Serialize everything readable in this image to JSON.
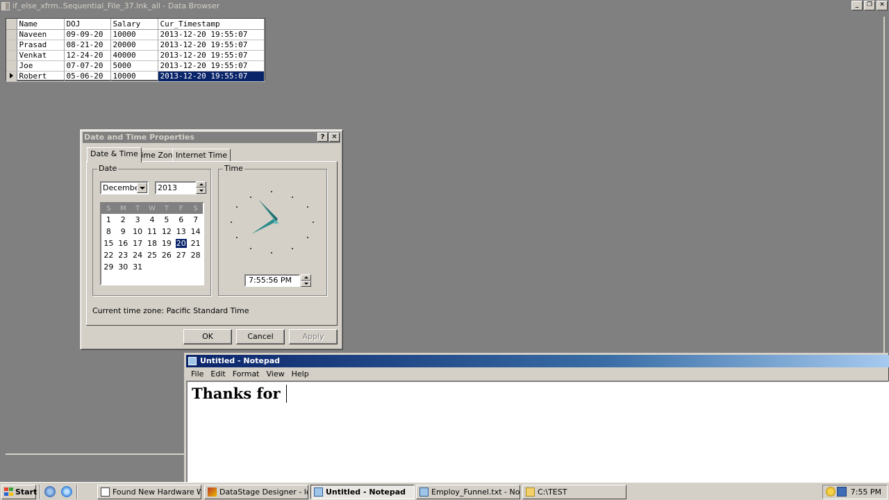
{
  "browser": {
    "title": "if_else_xfrm..Sequential_File_37.lnk_all - Data Browser",
    "columns": [
      "Name",
      "DOJ",
      "Salary",
      "Cur_Timestamp"
    ],
    "rows": [
      [
        "Naveen",
        "09-09-20",
        "10000",
        "2013-12-20 19:55:07"
      ],
      [
        "Prasad",
        "08-21-20",
        "20000",
        "2013-12-20 19:55:07"
      ],
      [
        "Venkat",
        "12-24-20",
        "40000",
        "2013-12-20 19:55:07"
      ],
      [
        "Joe",
        "07-07-20",
        "5000",
        "2013-12-20 19:55:07"
      ],
      [
        "Robert",
        "05-06-20",
        "10000",
        "2013-12-20 19:55:07"
      ]
    ]
  },
  "datetime_dialog": {
    "title": "Date and Time Properties",
    "help_btn": "?",
    "close_btn": "✕",
    "tabs": [
      "Date & Time",
      "Time Zone",
      "Internet Time"
    ],
    "date_group": "Date",
    "time_group": "Time",
    "month": "December",
    "year": "2013",
    "weekdays": [
      "S",
      "M",
      "T",
      "W",
      "T",
      "F",
      "S"
    ],
    "weeks": [
      [
        "1",
        "2",
        "3",
        "4",
        "5",
        "6",
        "7"
      ],
      [
        "8",
        "9",
        "10",
        "11",
        "12",
        "13",
        "14"
      ],
      [
        "15",
        "16",
        "17",
        "18",
        "19",
        "20",
        "21"
      ],
      [
        "22",
        "23",
        "24",
        "25",
        "26",
        "27",
        "28"
      ],
      [
        "29",
        "30",
        "31",
        "",
        "",
        "",
        ""
      ]
    ],
    "selected_day": "20",
    "time_value": "7:55:56 PM",
    "timezone_label": "Current time zone:  Pacific Standard Time",
    "ok": "OK",
    "cancel": "Cancel",
    "apply": "Apply",
    "clock_color": "#2e8b8b"
  },
  "notepad": {
    "title": "Untitled - Notepad",
    "menu": [
      "File",
      "Edit",
      "Format",
      "View",
      "Help"
    ],
    "text": "Thanks for "
  },
  "taskbar": {
    "start": "Start",
    "tasks": [
      "Found New Hardware Wi...",
      "DataStage Designer - loc...",
      "Untitled - Notepad",
      "Employ_Funnel.txt - Not...",
      "C:\\TEST"
    ],
    "clock": "7:55 PM"
  }
}
